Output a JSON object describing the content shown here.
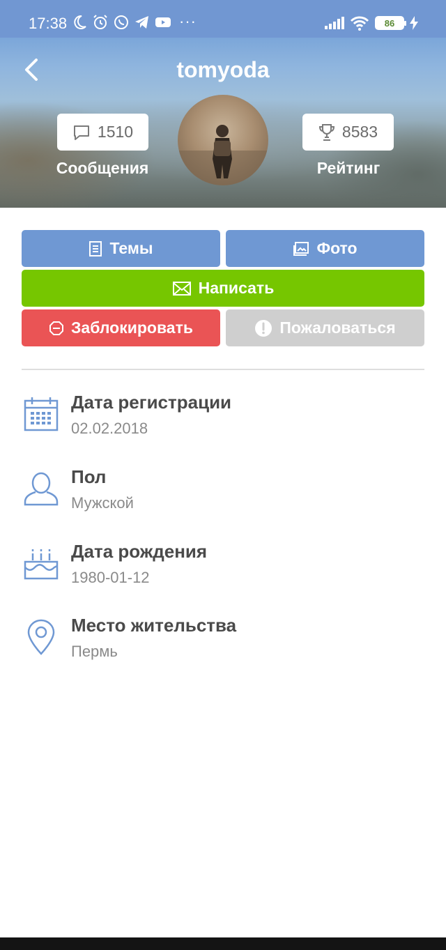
{
  "status_bar": {
    "time": "17:38",
    "dots": "···",
    "battery": "86",
    "icons": [
      "moon-icon",
      "alarm-icon",
      "whatsapp-icon",
      "telegram-icon",
      "youtube-icon",
      "signal-icon",
      "wifi-icon",
      "charging-icon"
    ]
  },
  "profile": {
    "username": "tomyoda",
    "messages_count": "1510",
    "messages_label": "Сообщения",
    "rating_count": "8583",
    "rating_label": "Рейтинг"
  },
  "buttons": {
    "topics": "Темы",
    "photos": "Фото",
    "write": "Написать",
    "block": "Заблокировать",
    "report": "Пожаловаться"
  },
  "info": [
    {
      "title": "Дата регистрации",
      "value": "02.02.2018",
      "icon": "calendar-icon"
    },
    {
      "title": "Пол",
      "value": "Мужской",
      "icon": "person-icon"
    },
    {
      "title": "Дата рождения",
      "value": "1980-01-12",
      "icon": "birthday-cake-icon"
    },
    {
      "title": "Место жительства",
      "value": "Пермь",
      "icon": "location-pin-icon"
    }
  ],
  "colors": {
    "header_blue": "#7197d2",
    "button_blue": "#6f98d3",
    "button_green": "#76c600",
    "button_red": "#ea5455",
    "button_grey": "#cfcfcf",
    "icon_blue": "#6f98d3"
  }
}
